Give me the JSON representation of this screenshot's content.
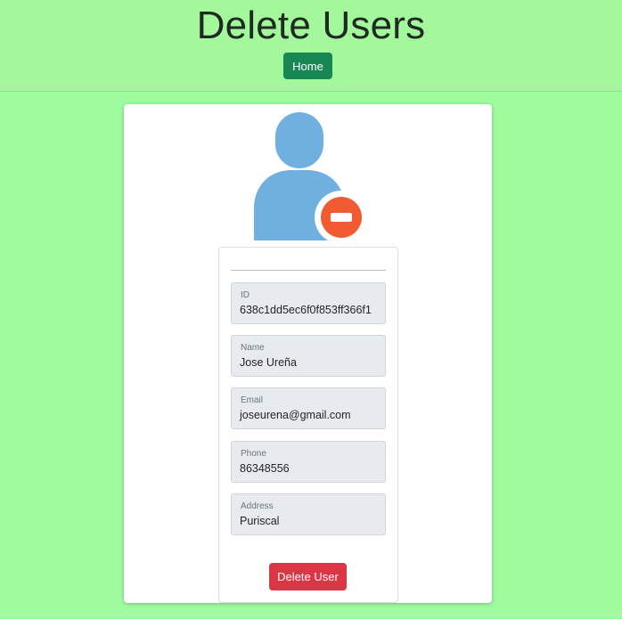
{
  "header": {
    "title": "Delete Users",
    "home_label": "Home"
  },
  "colors": {
    "background": "#9efb9e",
    "home_button": "#198754",
    "delete_button": "#dc3545",
    "avatar": "#6fb0e0",
    "remove_badge": "#f25a32"
  },
  "avatar": {
    "icon": "user-remove-icon"
  },
  "form": {
    "fields": [
      {
        "label": "ID",
        "value": "638c1dd5ec6f0f853ff366f1"
      },
      {
        "label": "Name",
        "value": "Jose Ureña"
      },
      {
        "label": "Email",
        "value": "joseurena@gmail.com"
      },
      {
        "label": "Phone",
        "value": "86348556"
      },
      {
        "label": "Address",
        "value": "Puriscal"
      }
    ],
    "delete_label": "Delete User"
  }
}
